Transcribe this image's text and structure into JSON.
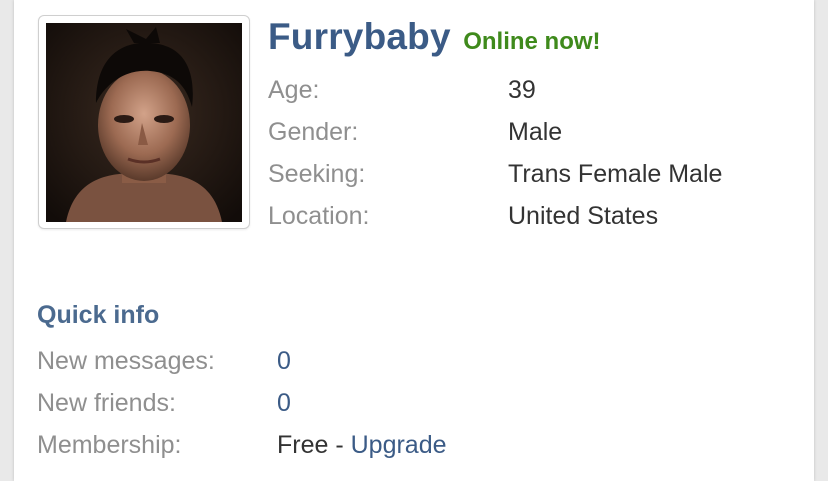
{
  "profile": {
    "username": "Furrybaby",
    "status": "Online now!",
    "photo_icon": "profile-photo",
    "details": [
      {
        "label": "Age:",
        "value": "39"
      },
      {
        "label": "Gender:",
        "value": "Male"
      },
      {
        "label": "Seeking:",
        "value": "Trans Female Male"
      },
      {
        "label": "Location:",
        "value": "United States"
      }
    ]
  },
  "quick_info": {
    "title": "Quick info",
    "new_messages": {
      "label": "New messages:",
      "value": "0"
    },
    "new_friends": {
      "label": "New friends:",
      "value": "0"
    },
    "membership": {
      "label": "Membership:",
      "value": "Free",
      "separator": " - ",
      "upgrade_label": "Upgrade"
    }
  },
  "colors": {
    "accent": "#4b6a8f",
    "online": "#3f8a1c",
    "link": "#3b5b86",
    "label": "#8f8f8f"
  }
}
